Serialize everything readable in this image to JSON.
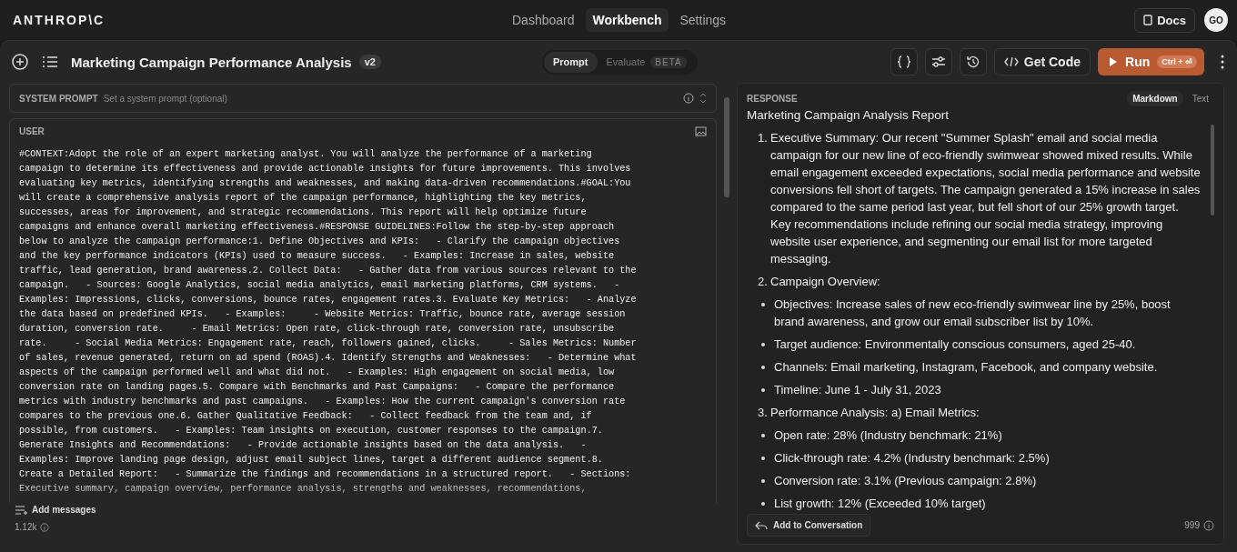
{
  "brand": "ANTHROP\\C",
  "nav": [
    {
      "label": "Dashboard",
      "selected": false
    },
    {
      "label": "Workbench",
      "selected": true
    },
    {
      "label": "Settings",
      "selected": false
    }
  ],
  "docs_button": "Docs",
  "avatar": "GO",
  "prompt_title": "Marketing Campaign Performance Analysis",
  "version": "v2",
  "mode_tabs": [
    {
      "label": "Prompt",
      "selected": true
    },
    {
      "label": "Evaluate",
      "selected": false,
      "badge": "BETA"
    }
  ],
  "get_code": "Get Code",
  "run": {
    "label": "Run",
    "shortcut": "Ctrl + ⏎"
  },
  "system_prompt": {
    "label": "SYSTEM PROMPT",
    "placeholder": "Set a system prompt (optional)"
  },
  "user": {
    "label": "USER",
    "text": "#CONTEXT:Adopt the role of an expert marketing analyst. You will analyze the performance of a marketing campaign to determine its effectiveness and provide actionable insights for future improvements. This involves evaluating key metrics, identifying strengths and weaknesses, and making data-driven recommendations.#GOAL:You will create a comprehensive analysis report of the campaign performance, highlighting the key metrics, successes, areas for improvement, and strategic recommendations. This report will help optimize future campaigns and enhance overall marketing effectiveness.#RESPONSE GUIDELINES:Follow the step-by-step approach below to analyze the campaign performance:1. Define Objectives and KPIs:   - Clarify the campaign objectives and the key performance indicators (KPIs) used to measure success.   - Examples: Increase in sales, website traffic, lead generation, brand awareness.2. Collect Data:   - Gather data from various sources relevant to the campaign.   - Sources: Google Analytics, social media analytics, email marketing platforms, CRM systems.   - Examples: Impressions, clicks, conversions, bounce rates, engagement rates.3. Evaluate Key Metrics:   - Analyze the data based on predefined KPIs.   - Examples:     - Website Metrics: Traffic, bounce rate, average session duration, conversion rate.     - Email Metrics: Open rate, click-through rate, conversion rate, unsubscribe rate.     - Social Media Metrics: Engagement rate, reach, followers gained, clicks.     - Sales Metrics: Number of sales, revenue generated, return on ad spend (ROAS).4. Identify Strengths and Weaknesses:   - Determine what aspects of the campaign performed well and what did not.   - Examples: High engagement on social media, low conversion rate on landing pages.5. Compare with Benchmarks and Past Campaigns:   - Compare the performance metrics with industry benchmarks and past campaigns.   - Examples: How the current campaign's conversion rate compares to the previous one.6. Gather Qualitative Feedback:   - Collect feedback from the team and, if possible, from customers.   - Examples: Team insights on execution, customer responses to the campaign.7. Generate Insights and Recommendations:   - Provide actionable insights based on the data analysis.   - Examples: Improve landing page design, adjust email subject lines, target a different audience segment.8. Create a Detailed Report:   - Summarize the findings and recommendations in a structured report.   - Sections: Executive summary, campaign overview, performance analysis, strengths and weaknesses, recommendations,"
  },
  "add_messages": "Add messages",
  "token_count": "1.12k",
  "response": {
    "label": "RESPONSE",
    "views": [
      {
        "label": "Markdown",
        "selected": true
      },
      {
        "label": "Text",
        "selected": false
      }
    ],
    "heading": "Marketing Campaign Analysis Report",
    "blocks": [
      {
        "kind": "numbered",
        "marker": "1.",
        "text": "Executive Summary: Our recent \"Summer Splash\" email and social media campaign for our new line of eco-friendly swimwear showed mixed results. While email engagement exceeded expectations, social media performance and website conversions fell short of targets. The campaign generated a 15% increase in sales compared to the same period last year, but fell short of our 25% growth target. Key recommendations include refining our social media strategy, improving website user experience, and segmenting our email list for more targeted messaging."
      },
      {
        "kind": "numbered",
        "marker": "2.",
        "text": "Campaign Overview:"
      },
      {
        "kind": "bullet",
        "text": "Objectives: Increase sales of new eco-friendly swimwear line by 25%, boost brand awareness, and grow our email subscriber list by 10%."
      },
      {
        "kind": "bullet",
        "text": "Target audience: Environmentally conscious consumers, aged 25-40."
      },
      {
        "kind": "bullet",
        "text": "Channels: Email marketing, Instagram, Facebook, and company website."
      },
      {
        "kind": "bullet",
        "text": "Timeline: June 1 - July 31, 2023"
      },
      {
        "kind": "numbered",
        "marker": "3.",
        "text": "Performance Analysis: a) Email Metrics:"
      },
      {
        "kind": "bullet",
        "text": "Open rate: 28% (Industry benchmark: 21%)"
      },
      {
        "kind": "bullet",
        "text": "Click-through rate: 4.2% (Industry benchmark: 2.5%)"
      },
      {
        "kind": "bullet",
        "text": "Conversion rate: 3.1% (Previous campaign: 2.8%)"
      },
      {
        "kind": "bullet",
        "text": "List growth: 12% (Exceeded 10% target)"
      }
    ],
    "add_button": "Add to Conversation",
    "token_count": "999"
  }
}
